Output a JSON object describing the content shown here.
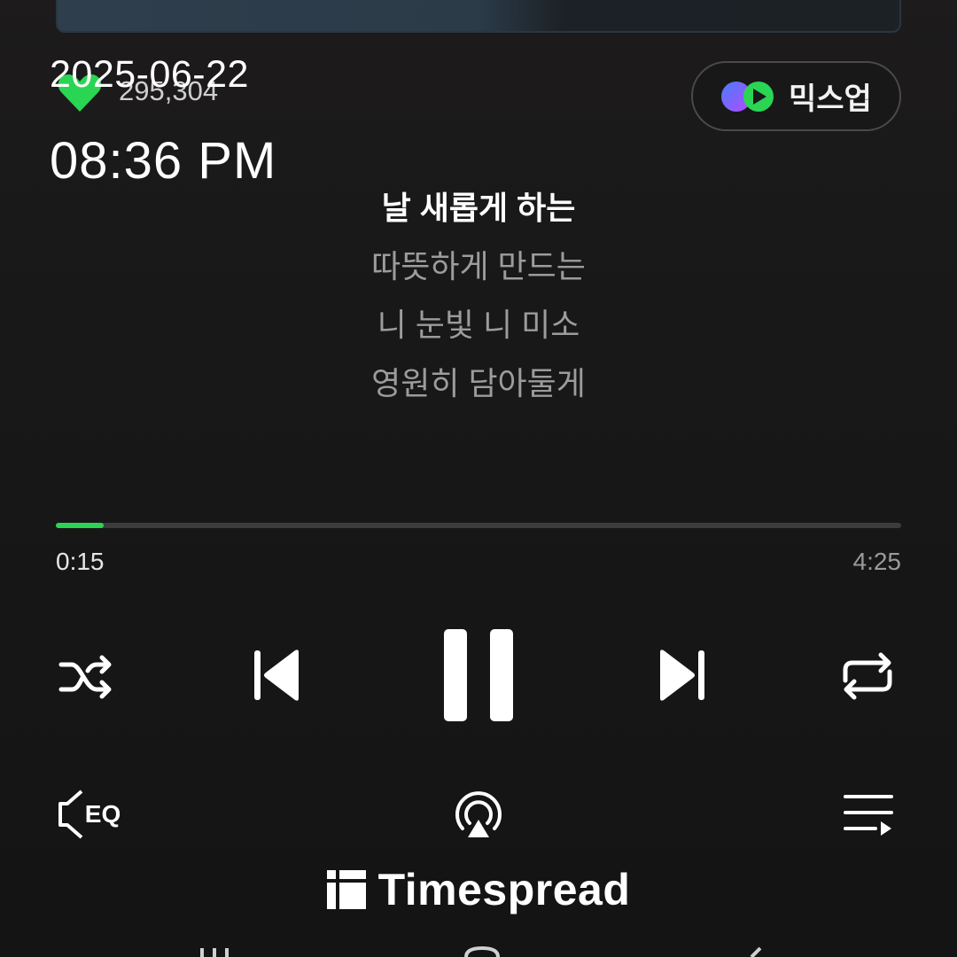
{
  "overlay": {
    "date": "2025-06-22",
    "time": "08:36 PM"
  },
  "track": {
    "like_count": "295,304",
    "like_icon": "heart-icon",
    "like_color": "#2ad553"
  },
  "mixup": {
    "label": "믹스업",
    "icon": "mixup-icon"
  },
  "lyrics": {
    "lines": [
      {
        "text": "날 새롭게 하는",
        "current": true
      },
      {
        "text": "따뜻하게 만드는",
        "current": false
      },
      {
        "text": "니 눈빛 니 미소",
        "current": false
      },
      {
        "text": "영원히 담아둘게",
        "current": false
      }
    ]
  },
  "playback": {
    "elapsed": "0:15",
    "total": "4:25",
    "progress_fraction": 0.057,
    "accent_color": "#2ad553"
  },
  "controls": {
    "shuffle": "shuffle-icon",
    "previous": "previous-icon",
    "play_state": "pause-icon",
    "next": "next-icon",
    "repeat": "repeat-icon",
    "equalizer_label": "EQ",
    "cast": "cast-icon",
    "playlist": "playlist-icon"
  },
  "watermark": {
    "name": "Timespread",
    "icon": "timespread-logo-icon"
  },
  "navigation": {
    "recent": "recent-apps-icon",
    "home": "home-icon",
    "back": "back-icon"
  }
}
